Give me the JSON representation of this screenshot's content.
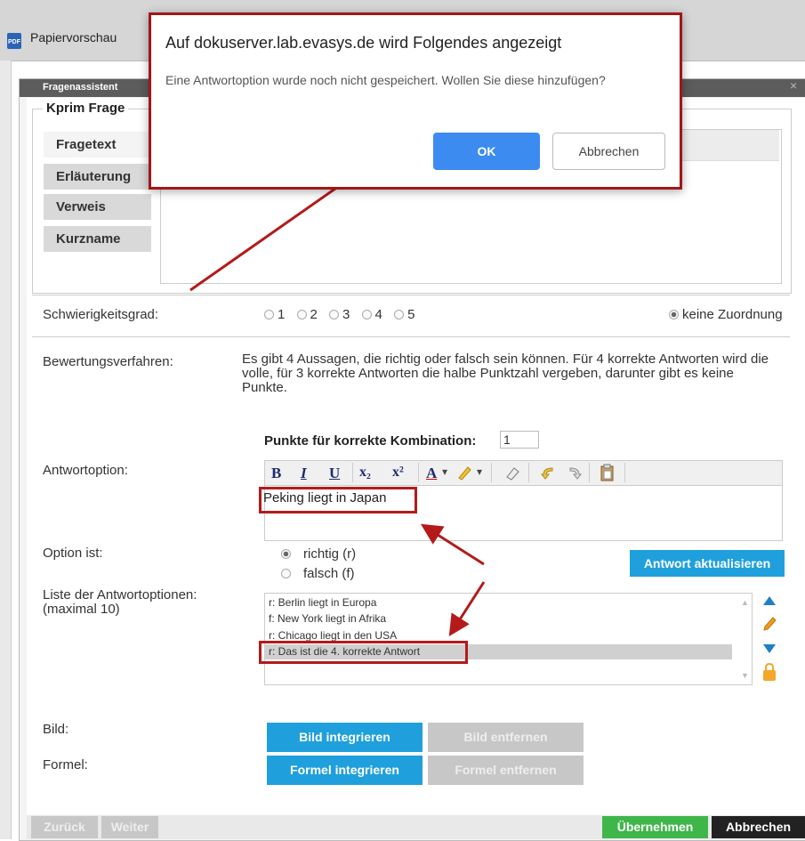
{
  "window": {
    "title": "Papiervorschau"
  },
  "dialog": {
    "title": "Fragenassistent",
    "close_glyph": "×"
  },
  "question": {
    "type_label": "Kprim Frage"
  },
  "tabs": [
    "Fragetext",
    "Erläuterung",
    "Verweis",
    "Kurzname"
  ],
  "difficulty": {
    "label": "Schwierigkeitsgrad:",
    "options": [
      "1",
      "2",
      "3",
      "4",
      "5"
    ],
    "no_assignment": "keine Zuordnung",
    "selected": "keine Zuordnung"
  },
  "rating": {
    "label": "Bewertungsverfahren:",
    "description": "Es gibt 4 Aussagen, die richtig oder falsch sein können. Für 4 korrekte Antworten wird die volle, für 3 korrekte Antworten die halbe Punktzahl vergeben, darunter gibt es keine Punkte."
  },
  "points": {
    "label": "Punkte für korrekte Kombination:",
    "value": "1"
  },
  "answer_option": {
    "label": "Antwortoption:",
    "text": "Peking liegt in Japan",
    "toolbar": {
      "bold": "B",
      "italic": "I",
      "underline": "U",
      "subscript": "x₂",
      "superscript": "x²",
      "font_color": "A",
      "dropdown": "▾"
    }
  },
  "option_is": {
    "label": "Option ist:",
    "choices": [
      "richtig (r)",
      "falsch (f)"
    ],
    "selected": "richtig (r)",
    "update_button": "Antwort aktualisieren"
  },
  "answer_list": {
    "label": "Liste der Antwortoptionen:",
    "sublabel": "(maximal 10)",
    "items": [
      "r: Berlin liegt in Europa",
      "f: New York liegt in Afrika",
      "r: Chicago liegt in den USA",
      "r: Das ist die 4. korrekte Antwort"
    ],
    "selected_index": 3
  },
  "image": {
    "label": "Bild:",
    "add_button": "Bild integrieren",
    "remove_button": "Bild entfernen"
  },
  "formula": {
    "label": "Formel:",
    "add_button": "Formel integrieren",
    "remove_button": "Formel entfernen"
  },
  "footer": {
    "back": "Zurück",
    "next": "Weiter",
    "apply": "Übernehmen",
    "cancel": "Abbrechen"
  },
  "alert": {
    "title": "Auf dokuserver.lab.evasys.de wird Folgendes angezeigt",
    "message": "Eine Antwortoption wurde noch nicht gespeichert. Wollen Sie diese hinzufügen?",
    "ok": "OK",
    "cancel": "Abbrechen"
  },
  "colors": {
    "accent_blue": "#1fa0dc",
    "apply_green": "#3fb649",
    "highlight_red": "#b41a1a",
    "ok_blue": "#3b8bf0"
  }
}
